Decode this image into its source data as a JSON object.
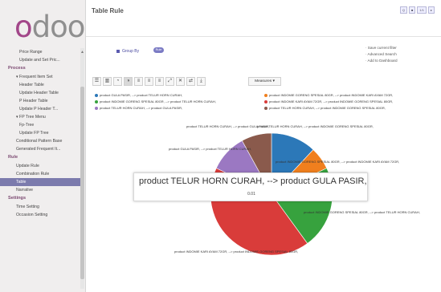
{
  "logo": "odoo",
  "sidebar": {
    "items": [
      {
        "label": "Price Range",
        "kind": "sub2"
      },
      {
        "label": "Update and Set Pric...",
        "kind": "sub2"
      },
      {
        "label": "Process",
        "kind": "head"
      },
      {
        "label": "▾ Frequent Item Set",
        "kind": "sub"
      },
      {
        "label": "Header Table",
        "kind": "sub2"
      },
      {
        "label": "Update Header Table",
        "kind": "sub2"
      },
      {
        "label": "P Header Table",
        "kind": "sub2"
      },
      {
        "label": "Update P Header T...",
        "kind": "sub2"
      },
      {
        "label": "▾ FP Tree Menu",
        "kind": "sub"
      },
      {
        "label": "Fp-Tree",
        "kind": "sub2"
      },
      {
        "label": "Update FP Tree",
        "kind": "sub2"
      },
      {
        "label": "Conditional Pattern Base",
        "kind": "sub"
      },
      {
        "label": "Generated Frequent It...",
        "kind": "sub"
      },
      {
        "label": "Rule",
        "kind": "head"
      },
      {
        "label": "Update Rule",
        "kind": "sub"
      },
      {
        "label": "Combination Rule",
        "kind": "sub"
      },
      {
        "label": "Table",
        "kind": "active"
      },
      {
        "label": "Narrative",
        "kind": "sub"
      },
      {
        "label": "Settings",
        "kind": "head"
      },
      {
        "label": "Time Setting",
        "kind": "sub"
      },
      {
        "label": "Occasion Setting",
        "kind": "sub"
      }
    ]
  },
  "header": {
    "title": "Table Rule",
    "pager": [
      "Q",
      "■",
      "1/1",
      "▸"
    ]
  },
  "search": {
    "groupby_label": "Group By",
    "pill": "Rule",
    "filters": [
      "· Save current filter",
      "· Advanced Search",
      "· Add to Dashboard"
    ]
  },
  "toolbar": {
    "buttons": [
      "☰",
      "▥",
      "◔",
      "◑",
      "≡",
      "≡",
      "≡",
      "⤢",
      "✕",
      "⇄",
      "⤓"
    ],
    "measures": "Measures ▾"
  },
  "colors": {
    "blue": "#2c78b8",
    "orange": "#f07f1e",
    "green": "#37a23e",
    "red": "#d93c3a",
    "purple": "#9b78c2",
    "brown": "#8a5a4c",
    "sidebar_active": "#7c7bad",
    "brand": "#a24689"
  },
  "legend": [
    {
      "label": "product GULA PASIR, --> product TELUR HORN CURAH,",
      "color": "#2c78b8"
    },
    {
      "label": "product INDOMIE GORENG SPESIAL 80GR, --> product INDOMIE KARI AYAM 72GR,",
      "color": "#f07f1e"
    },
    {
      "label": "product INDOMIE GORENG SPESIAL 80GR, --> product TELUR HORN CURAH,",
      "color": "#37a23e"
    },
    {
      "label": "product INDOMIE KARI AYAM 72GR, --> product INDOMIE GORENG SPESIAL 80GR,",
      "color": "#d93c3a"
    },
    {
      "label": "product TELUR HORN CURAH, --> product GULA PASIR,",
      "color": "#9b78c2"
    },
    {
      "label": "product TELUR HORN CURAH, --> product INDOMIE GORENG SPESIAL 80GR,",
      "color": "#8a5a4c"
    }
  ],
  "chart_data": {
    "type": "pie",
    "labels": [
      "product GULA PASIR, --> product TELUR HORN CURAH,",
      "product INDOMIE GORENG SPESIAL 80GR, --> product INDOMIE KARI AYAM 72GR,",
      "product INDOMIE GORENG SPESIAL 80GR, --> product TELUR HORN CURAH,",
      "product INDOMIE KARI AYAM 72GR, --> product INDOMIE GORENG SPESIAL 80GR,",
      "product TELUR HORN CURAH, --> product GULA PASIR,",
      "product TELUR HORN CURAH, --> product INDOMIE GORENG SPESIAL 80GR,"
    ],
    "values": [
      0.12,
      0.06,
      0.22,
      0.42,
      0.1,
      0.08
    ],
    "colors": [
      "#2c78b8",
      "#f07f1e",
      "#37a23e",
      "#d93c3a",
      "#9b78c2",
      "#8a5a4c"
    ],
    "slice_labels": [
      "product TELUR HORN CURAH, --> product GULA PASIR,",
      "product TELUR HORN CURAH, --> product INDOMIE GORENG SPESIAL 80GR,",
      "product GULA PASIR, --> product TELUR HORN CURAH,",
      "product INDOMIE GORENG SPESIAL 80GR, --> product INDOMIE KARI AYAM 72GR,",
      "product INDOMIE GORENG SPESIAL 80GR, --> product TELUR HORN CURAH,",
      "product INDOMIE KARI AYAM 72GR, --> product INDOMIE GORENG SPESIAL 80GR,"
    ],
    "tooltip": {
      "title": "product TELUR HORN CURAH, --> product GULA PASIR,",
      "value": "0.01"
    }
  }
}
